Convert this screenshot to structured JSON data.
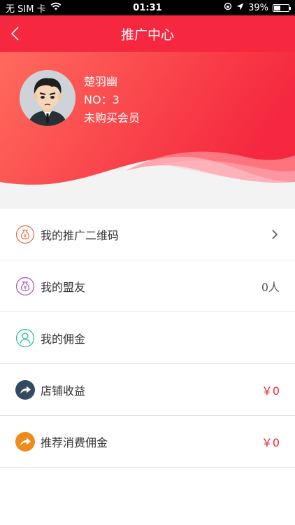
{
  "status_bar": {
    "carrier": "无 SIM 卡",
    "time": "01:31",
    "battery": "39%"
  },
  "nav": {
    "title": "推广中心"
  },
  "profile": {
    "name": "楚羽幽",
    "number": "NO：3",
    "membership": "未购买会员"
  },
  "menu": [
    {
      "label": "我的推广二维码",
      "value": "",
      "icon": "money-bag-icon",
      "color": "#e8704a"
    },
    {
      "label": "我的盟友",
      "value": "0人",
      "icon": "money-bag-icon",
      "color": "#a65cc0"
    },
    {
      "label": "我的佣金",
      "value": "",
      "icon": "person-icon",
      "color": "#2ebfa5"
    },
    {
      "label": "店铺收益",
      "value": "￥0",
      "icon": "share-arrow-icon",
      "color": "#344a61"
    },
    {
      "label": "推荐消费佣金",
      "value": "￥0",
      "icon": "share-arrow-icon",
      "color": "#f08a1c"
    }
  ],
  "colors": {
    "brand_red": "#f5283f",
    "value_red": "#e8293b"
  }
}
